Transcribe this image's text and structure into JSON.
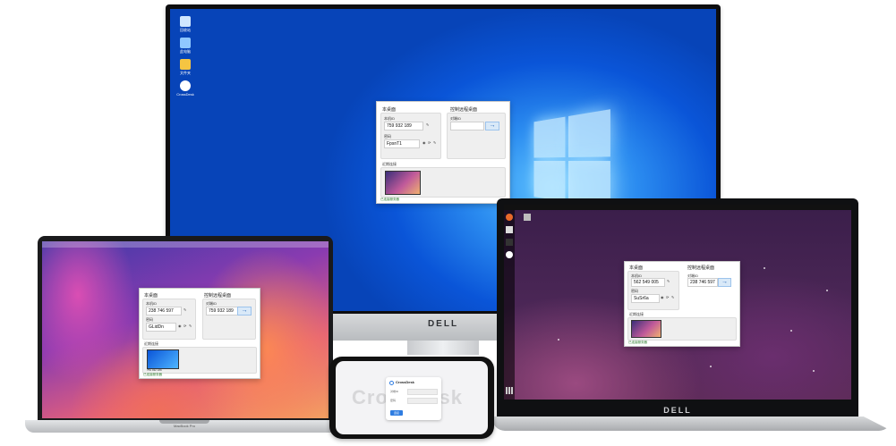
{
  "monitor": {
    "brand": "DELL",
    "desktop_icons": [
      {
        "label": "回收站",
        "icon": "recycle-bin-icon",
        "color": "#cfe7ff"
      },
      {
        "label": "此电脑",
        "icon": "computer-icon",
        "color": "#8fc8ff"
      },
      {
        "label": "文件夹",
        "icon": "folder-icon",
        "color": "#f5c542"
      },
      {
        "label": "CrossDesk",
        "icon": "crossdesk-icon",
        "color": "#ffffff"
      }
    ],
    "window": {
      "local_title": "本桌面",
      "remote_title": "控制远程桌面",
      "id_label": "本机ID",
      "id_value": "759 932 189",
      "pw_label": "密码",
      "pw_value": "FpsnT1",
      "remote_id_label": "对端ID",
      "remote_id_value": "",
      "recent_label": "近期连接",
      "status": "已连接服务器"
    }
  },
  "macbook": {
    "label": "MacBook Pro",
    "window": {
      "local_title": "本桌面",
      "remote_title": "控制远程桌面",
      "id_label": "本机ID",
      "id_value": "238 746 597",
      "pw_label": "密码",
      "pw_value": "GLidDn",
      "remote_id_label": "对端ID",
      "remote_id_value": "759 932 189",
      "recent_label": "近期连接",
      "thumb_caption": "759 932 189",
      "status": "已连接服务器"
    }
  },
  "phone": {
    "watermark": "CrossDesk",
    "app_title": "CrossDesk",
    "fields": [
      "对端ID",
      "密码"
    ],
    "connect_label": "连接"
  },
  "laptop": {
    "brand": "DELL",
    "window": {
      "local_title": "本桌面",
      "remote_title": "控制远程桌面",
      "id_label": "本机ID",
      "id_value": "562 549 005",
      "pw_label": "密码",
      "pw_value": "SuSr6a",
      "remote_id_label": "对端ID",
      "remote_id_value": "238 746 597",
      "recent_label": "近期连接",
      "status": "已连接服务器"
    }
  },
  "icons": {
    "arrow": "→",
    "eye": "👁",
    "refresh": "⟳",
    "edit": "✎"
  }
}
